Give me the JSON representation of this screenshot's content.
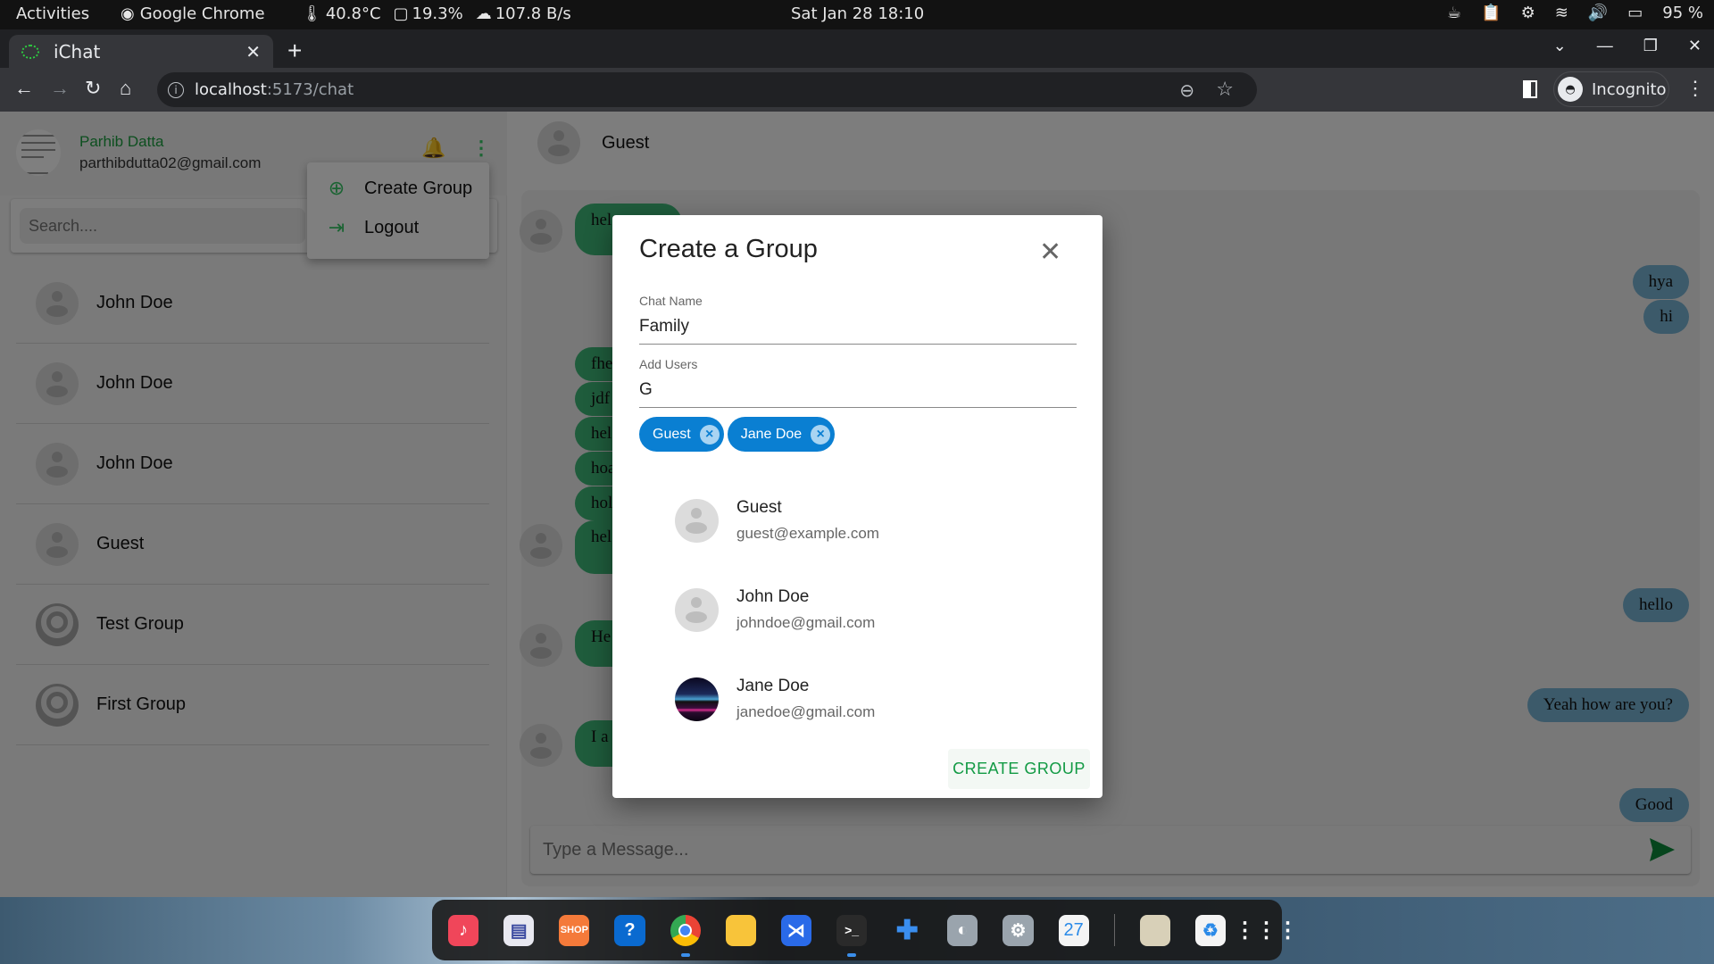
{
  "system": {
    "activities": "Activities",
    "app_name": "Google Chrome",
    "temperature": "40.8°C",
    "cpu": "19.3%",
    "network": "107.8 B/s",
    "clock": "Sat Jan 28  18:10",
    "battery": "95 %"
  },
  "browser": {
    "tab_title": "iChat",
    "url_host": "localhost",
    "url_path": ":5173/chat",
    "profile_label": "Incognito"
  },
  "user": {
    "name": "Parhib Datta",
    "email": "parthibdutta02@gmail.com"
  },
  "menu": {
    "items": [
      {
        "label": "Create Group",
        "icon": "add-circle-icon"
      },
      {
        "label": "Logout",
        "icon": "logout-icon"
      }
    ]
  },
  "search": {
    "placeholder": "Search...."
  },
  "chats": [
    {
      "name": "John Doe",
      "type": "user"
    },
    {
      "name": "John Doe",
      "type": "user"
    },
    {
      "name": "John Doe",
      "type": "user"
    },
    {
      "name": "Guest",
      "type": "user"
    },
    {
      "name": "Test Group",
      "type": "group"
    },
    {
      "name": "First Group",
      "type": "group"
    }
  ],
  "active_chat": {
    "name": "Guest",
    "messages_incoming_visible": [
      "hel",
      "fhe",
      "jdf",
      "hel",
      "hoa",
      "hol",
      "hel",
      "He",
      "I a"
    ],
    "messages_outgoing": [
      "hya",
      "hi",
      "hello",
      "Yeah how are you?",
      "Good"
    ]
  },
  "composer": {
    "placeholder": "Type a Message..."
  },
  "dialog": {
    "title": "Create a Group",
    "chat_name_label": "Chat Name",
    "chat_name_value": "Family",
    "add_users_label": "Add Users",
    "add_users_value": "G",
    "selected": [
      "Guest",
      "Jane Doe"
    ],
    "results": [
      {
        "name": "Guest",
        "email": "guest@example.com"
      },
      {
        "name": "John Doe",
        "email": "johndoe@gmail.com"
      },
      {
        "name": "Jane Doe",
        "email": "janedoe@gmail.com"
      }
    ],
    "submit_label": "CREATE GROUP"
  },
  "dock": {
    "apps": [
      "Rhythmbox",
      "LibreOffice Writer",
      "Ubuntu Software",
      "Help",
      "Google Chrome",
      "Files",
      "Visual Studio Code",
      "Terminal",
      "Extensions",
      "Tweaks",
      "Settings",
      "Calendar",
      "Disks",
      "Trash",
      "Show Applications"
    ],
    "calendar_day": "27"
  },
  "colors": {
    "brand_green": "#1a9e3f",
    "chip_blue": "#0a7fd2",
    "incoming_bubble": "#3fb878",
    "outgoing_bubble": "#78b4d4"
  }
}
